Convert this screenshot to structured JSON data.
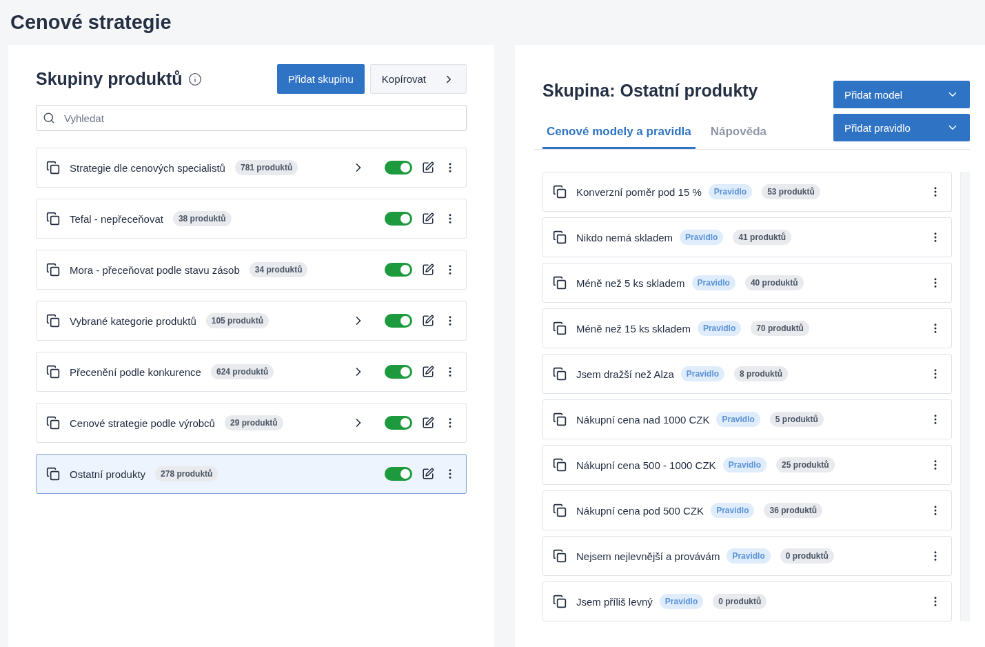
{
  "page_title": "Cenové strategie",
  "groups_panel": {
    "title": "Skupiny produktů",
    "add_button": "Přidat skupinu",
    "copy_button": "Kopírovat",
    "search": {
      "placeholder": "Vyhledat"
    },
    "groups": [
      {
        "name": "Strategie dle cenových specialistů",
        "count": "781 produktů",
        "has_children": true,
        "on": true,
        "selected": false
      },
      {
        "name": "Tefal - nepřeceňovat",
        "count": "38 produktů",
        "has_children": false,
        "on": true,
        "selected": false
      },
      {
        "name": "Mora - přeceňovat podle stavu zásob",
        "count": "34 produktů",
        "has_children": false,
        "on": true,
        "selected": false
      },
      {
        "name": "Vybrané kategorie produktů",
        "count": "105 produktů",
        "has_children": true,
        "on": true,
        "selected": false
      },
      {
        "name": "Přecenění podle konkurence",
        "count": "624 produktů",
        "has_children": true,
        "on": true,
        "selected": false
      },
      {
        "name": "Cenové strategie podle výrobců",
        "count": "29 produktů",
        "has_children": true,
        "on": true,
        "selected": false
      },
      {
        "name": "Ostatní produkty",
        "count": "278 produktů",
        "has_children": false,
        "on": true,
        "selected": true
      }
    ]
  },
  "detail_panel": {
    "title": "Skupina: Ostatní produkty",
    "buttons": [
      "Přidat model",
      "Přidat pravidlo"
    ],
    "tabs": [
      {
        "label": "Cenové modely a pravidla",
        "selected": true
      },
      {
        "label": "Nápověda",
        "selected": false
      }
    ],
    "rules": [
      {
        "name": "Konverzní poměr pod 15 %",
        "tag": "Pravidlo",
        "count": "53 produktů"
      },
      {
        "name": "Nikdo nemá skladem",
        "tag": "Pravidlo",
        "count": "41 produktů"
      },
      {
        "name": "Méně než 5 ks skladem",
        "tag": "Pravidlo",
        "count": "40 produktů"
      },
      {
        "name": "Méně než 15 ks skladem",
        "tag": "Pravidlo",
        "count": "70 produktů"
      },
      {
        "name": "Jsem dražší než Alza",
        "tag": "Pravidlo",
        "count": "8 produktů"
      },
      {
        "name": "Nákupní cena nad 1000 CZK",
        "tag": "Pravidlo",
        "count": "5 produktů"
      },
      {
        "name": "Nákupní cena 500 - 1000 CZK",
        "tag": "Pravidlo",
        "count": "25 produktů"
      },
      {
        "name": "Nákupní cena pod 500 CZK",
        "tag": "Pravidlo",
        "count": "36 produktů"
      },
      {
        "name": "Nejsem nejlevnější a provávám",
        "tag": "Pravidlo",
        "count": "0 produktů"
      },
      {
        "name": "Jsem příliš levný",
        "tag": "Pravidlo",
        "count": "0 produktů"
      }
    ]
  }
}
